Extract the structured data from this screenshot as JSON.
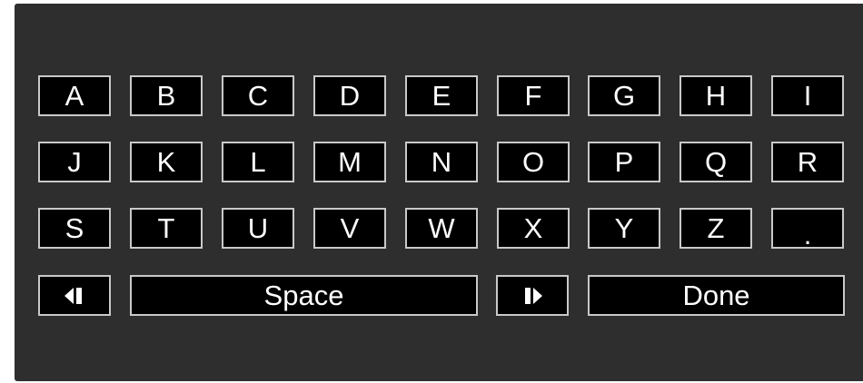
{
  "keyboard": {
    "rows": [
      [
        "A",
        "B",
        "C",
        "D",
        "E",
        "F",
        "G",
        "H",
        "I"
      ],
      [
        "J",
        "K",
        "L",
        "M",
        "N",
        "O",
        "P",
        "Q",
        "R"
      ],
      [
        "S",
        "T",
        "U",
        "V",
        "W",
        "X",
        "Y",
        "Z",
        "."
      ]
    ],
    "controls": {
      "cursor_left_icon": "cursor-left-icon",
      "space_label": "Space",
      "cursor_right_icon": "cursor-right-icon",
      "done_label": "Done"
    }
  },
  "colors": {
    "panel_background": "#2e2e2e",
    "key_background": "#000000",
    "key_border": "#c9c9c9",
    "key_text": "#ffffff"
  }
}
